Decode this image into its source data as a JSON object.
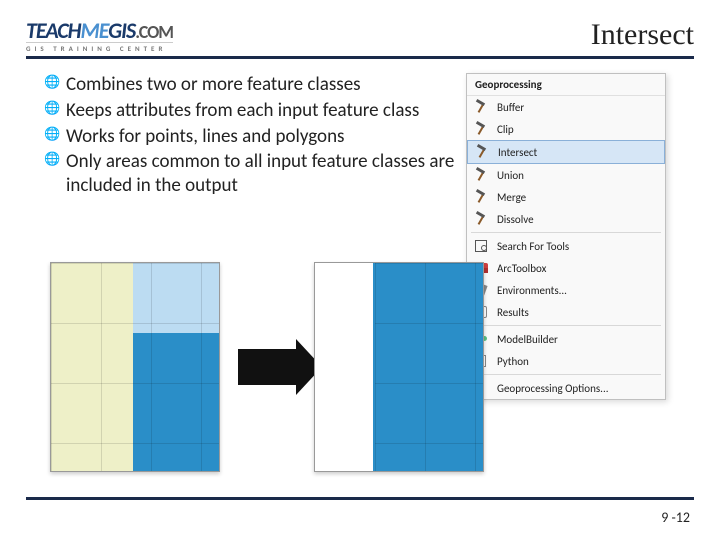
{
  "logo": {
    "part1": "TEACH",
    "part2": "ME",
    "part3": "GIS",
    "part4": ".COM",
    "sub": "GIS TRAINING CENTER"
  },
  "title": "Intersect",
  "bullets": [
    "Combines two or more feature classes",
    "Keeps attributes from each input feature class",
    "Works for points, lines and polygons",
    "Only areas common to all input feature classes are included in the output"
  ],
  "menu": {
    "header": "Geoprocessing",
    "tools": [
      "Buffer",
      "Clip",
      "Intersect",
      "Union",
      "Merge",
      "Dissolve"
    ],
    "highlighted": "Intersect",
    "search": "Search For Tools",
    "toolbox": "ArcToolbox",
    "env": "Environments...",
    "results": "Results",
    "model": "ModelBuilder",
    "python": "Python",
    "options": "Geoprocessing Options..."
  },
  "page": "9 -12"
}
